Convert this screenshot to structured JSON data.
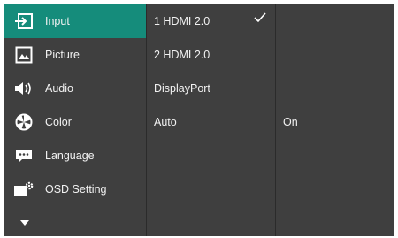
{
  "main_menu": {
    "items": [
      {
        "label": "Input",
        "icon": "input-icon",
        "active": true
      },
      {
        "label": "Picture",
        "icon": "picture-icon",
        "active": false
      },
      {
        "label": "Audio",
        "icon": "speaker-icon",
        "active": false
      },
      {
        "label": "Color",
        "icon": "color-wheel-icon",
        "active": false
      },
      {
        "label": "Language",
        "icon": "language-icon",
        "active": false
      },
      {
        "label": "OSD Setting",
        "icon": "osd-setting-icon",
        "active": false
      }
    ],
    "more_icon": "chevron-down-icon"
  },
  "submenu": {
    "items": [
      {
        "label": "1 HDMI 2.0",
        "selected": true
      },
      {
        "label": "2 HDMI 2.0",
        "selected": false
      },
      {
        "label": "DisplayPort",
        "selected": false
      },
      {
        "label": "Auto",
        "selected": false
      }
    ]
  },
  "value_panel": {
    "auto_value": "On"
  },
  "colors": {
    "accent": "#158c7b",
    "panel": "#3f3f3f",
    "divider": "#2b2b2b",
    "text": "#f2f2f2"
  }
}
